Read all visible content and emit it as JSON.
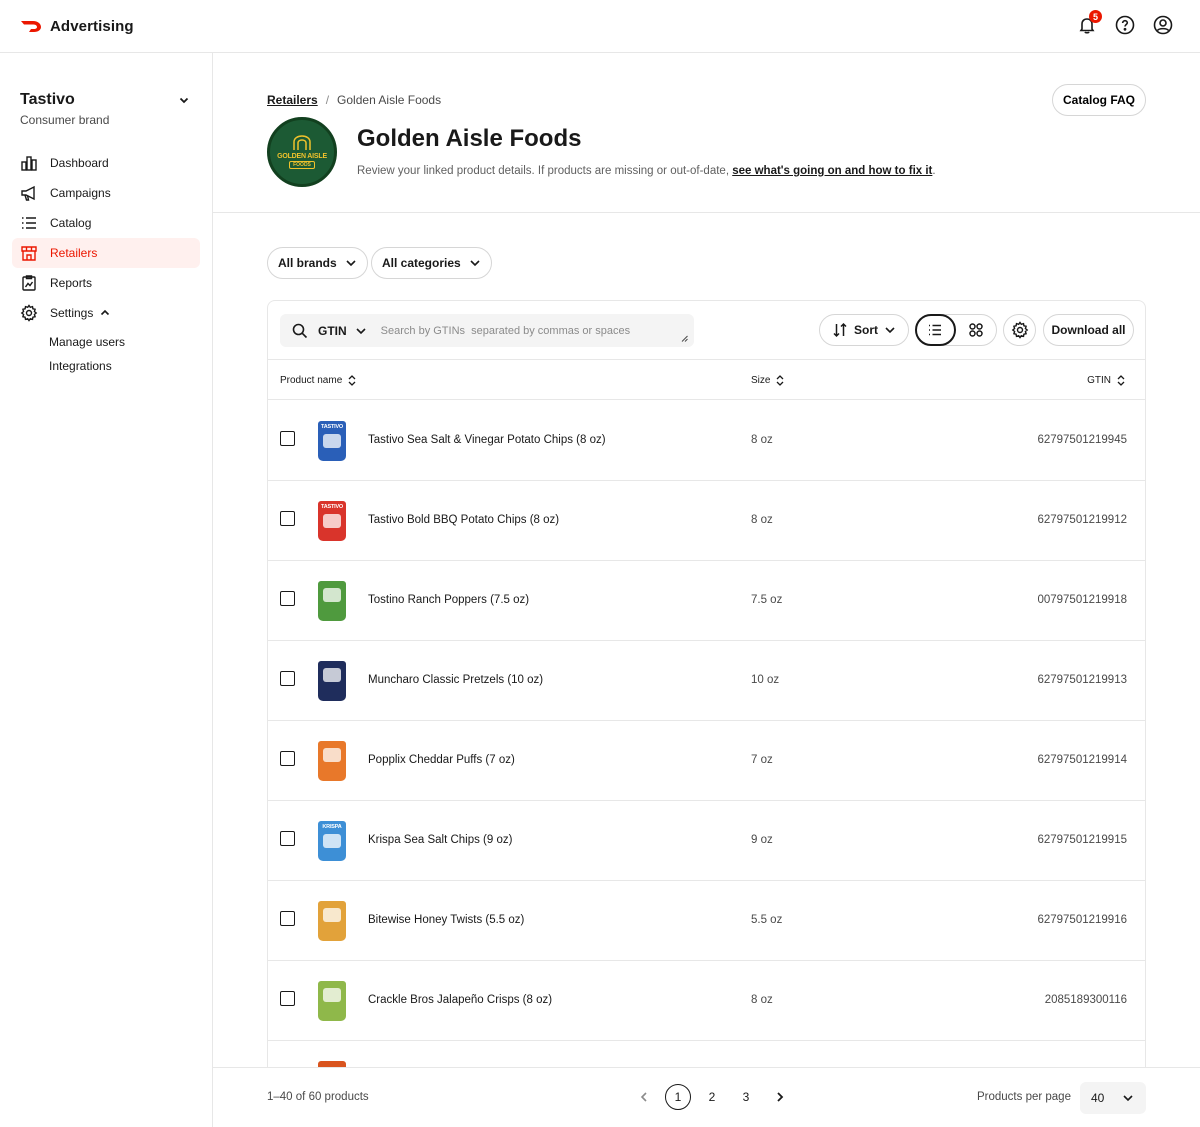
{
  "app": {
    "name": "Advertising",
    "notification_count": "5"
  },
  "account": {
    "name": "Tastivo",
    "type": "Consumer brand"
  },
  "nav": {
    "items": [
      {
        "label": "Dashboard",
        "icon": "bar-chart-icon"
      },
      {
        "label": "Campaigns",
        "icon": "megaphone-icon"
      },
      {
        "label": "Catalog",
        "icon": "list-icon"
      },
      {
        "label": "Retailers",
        "icon": "storefront-icon",
        "active": true
      },
      {
        "label": "Reports",
        "icon": "clipboard-chart-icon"
      },
      {
        "label": "Settings",
        "icon": "gear-icon",
        "expanded": true
      }
    ],
    "settings_sub": [
      "Manage users",
      "Integrations"
    ]
  },
  "breadcrumb": {
    "parent": "Retailers",
    "separator": "/",
    "current": "Golden Aisle Foods"
  },
  "header": {
    "faq_label": "Catalog FAQ",
    "title": "Golden Aisle Foods",
    "logo_line1": "GOLDEN AISLE",
    "logo_line2": "FOODS",
    "desc_prefix": "Review your linked product details. If products are missing or out-of-date, ",
    "desc_link": "see what's going on and how to fix it",
    "desc_suffix": "."
  },
  "filters": {
    "brands": "All brands",
    "categories": "All categories"
  },
  "toolbar": {
    "search_type": "GTIN",
    "search_placeholder": "Search by GTINs  separated by commas or spaces",
    "sort_label": "Sort",
    "download_label": "Download all",
    "view_mode": "list"
  },
  "table": {
    "columns": {
      "name": "Product name",
      "size": "Size",
      "gtin": "GTIN"
    },
    "rows": [
      {
        "name": "Tastivo Sea Salt & Vinegar Potato Chips (8 oz)",
        "size": "8 oz",
        "gtin": "62797501219945",
        "pack_color": "#2a5fb8",
        "pack_brand": "TASTIVO"
      },
      {
        "name": "Tastivo Bold BBQ Potato Chips (8 oz)",
        "size": "8 oz",
        "gtin": "62797501219912",
        "pack_color": "#d9342b",
        "pack_brand": "TASTIVO"
      },
      {
        "name": "Tostino Ranch Poppers (7.5 oz)",
        "size": "7.5 oz",
        "gtin": "00797501219918",
        "pack_color": "#4f9a3e",
        "pack_brand": ""
      },
      {
        "name": "Muncharo Classic Pretzels (10 oz)",
        "size": "10 oz",
        "gtin": "62797501219913",
        "pack_color": "#1f2d5c",
        "pack_brand": ""
      },
      {
        "name": "Popplix Cheddar Puffs (7 oz)",
        "size": "7 oz",
        "gtin": "62797501219914",
        "pack_color": "#e8782a",
        "pack_brand": ""
      },
      {
        "name": "Krispa Sea Salt Chips (9 oz)",
        "size": "9 oz",
        "gtin": "62797501219915",
        "pack_color": "#3d8fd6",
        "pack_brand": "KRISPA"
      },
      {
        "name": "Bitewise Honey Twists (5.5 oz)",
        "size": "5.5 oz",
        "gtin": "62797501219916",
        "pack_color": "#e2a23a",
        "pack_brand": ""
      },
      {
        "name": "Crackle Bros Jalapeño Crisps (8 oz)",
        "size": "8 oz",
        "gtin": "2085189300116",
        "pack_color": "#8fb84a",
        "pack_brand": ""
      }
    ]
  },
  "pagination": {
    "summary": "1–40 of 60 products",
    "pages": [
      "1",
      "2",
      "3"
    ],
    "current_page": "1",
    "per_page_label": "Products per page",
    "per_page_value": "40"
  },
  "colors": {
    "accent": "#eb1700",
    "active_bg": "#fff0ee",
    "logo_green": "#1c5a34",
    "logo_gold": "#f0c22c"
  }
}
